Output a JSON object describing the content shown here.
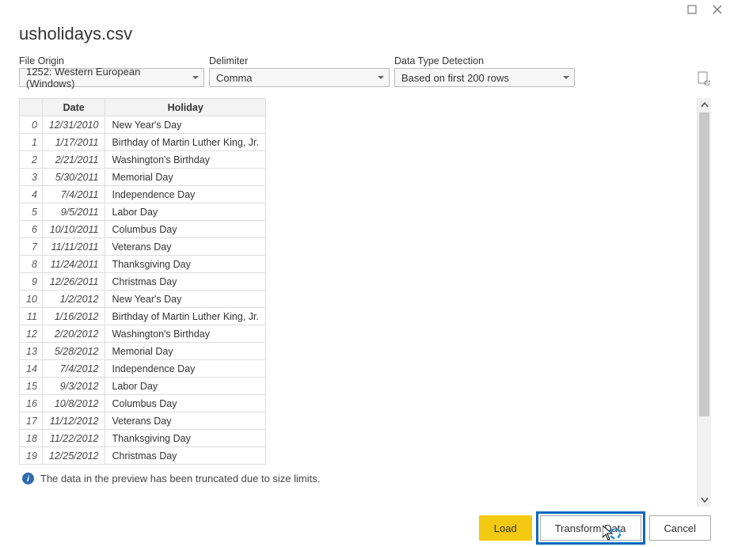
{
  "window": {
    "title": "usholidays.csv"
  },
  "controls": {
    "file_origin_label": "File Origin",
    "file_origin_value": "1252: Western European (Windows)",
    "delimiter_label": "Delimiter",
    "delimiter_value": "Comma",
    "detection_label": "Data Type Detection",
    "detection_value": "Based on first 200 rows"
  },
  "table": {
    "headers": {
      "date": "Date",
      "holiday": "Holiday"
    },
    "rows": [
      {
        "idx": "0",
        "date": "12/31/2010",
        "holiday": "New Year's Day"
      },
      {
        "idx": "1",
        "date": "1/17/2011",
        "holiday": "Birthday of Martin Luther King, Jr."
      },
      {
        "idx": "2",
        "date": "2/21/2011",
        "holiday": "Washington's Birthday"
      },
      {
        "idx": "3",
        "date": "5/30/2011",
        "holiday": "Memorial Day"
      },
      {
        "idx": "4",
        "date": "7/4/2011",
        "holiday": "Independence Day"
      },
      {
        "idx": "5",
        "date": "9/5/2011",
        "holiday": "Labor Day"
      },
      {
        "idx": "6",
        "date": "10/10/2011",
        "holiday": "Columbus Day"
      },
      {
        "idx": "7",
        "date": "11/11/2011",
        "holiday": "Veterans Day"
      },
      {
        "idx": "8",
        "date": "11/24/2011",
        "holiday": "Thanksgiving Day"
      },
      {
        "idx": "9",
        "date": "12/26/2011",
        "holiday": "Christmas Day"
      },
      {
        "idx": "10",
        "date": "1/2/2012",
        "holiday": "New Year's Day"
      },
      {
        "idx": "11",
        "date": "1/16/2012",
        "holiday": "Birthday of Martin Luther King, Jr."
      },
      {
        "idx": "12",
        "date": "2/20/2012",
        "holiday": "Washington's Birthday"
      },
      {
        "idx": "13",
        "date": "5/28/2012",
        "holiday": "Memorial Day"
      },
      {
        "idx": "14",
        "date": "7/4/2012",
        "holiday": "Independence Day"
      },
      {
        "idx": "15",
        "date": "9/3/2012",
        "holiday": "Labor Day"
      },
      {
        "idx": "16",
        "date": "10/8/2012",
        "holiday": "Columbus Day"
      },
      {
        "idx": "17",
        "date": "11/12/2012",
        "holiday": "Veterans Day"
      },
      {
        "idx": "18",
        "date": "11/22/2012",
        "holiday": "Thanksgiving Day"
      },
      {
        "idx": "19",
        "date": "12/25/2012",
        "holiday": "Christmas Day"
      }
    ]
  },
  "footnote": "The data in the preview has been truncated due to size limits.",
  "buttons": {
    "load": "Load",
    "transform": "Transform Data",
    "cancel": "Cancel"
  }
}
